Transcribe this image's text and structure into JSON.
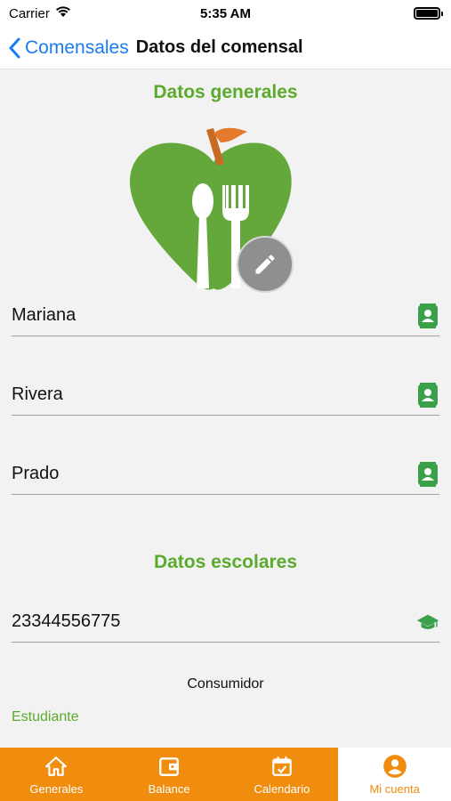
{
  "status_bar": {
    "carrier": "Carrier",
    "time": "5:35 AM"
  },
  "nav": {
    "back_label": "Comensales",
    "title": "Datos del comensal"
  },
  "general": {
    "title": "Datos generales",
    "fields": [
      {
        "value": "Mariana",
        "icon": "contact-card-icon"
      },
      {
        "value": "Rivera",
        "icon": "contact-card-icon"
      },
      {
        "value": "Prado",
        "icon": "contact-card-icon"
      }
    ]
  },
  "school": {
    "title": "Datos escolares",
    "id_value": "23344556775",
    "id_icon": "graduation-cap-icon",
    "consumer_label": "Consumidor",
    "consumer_type": "Estudiante"
  },
  "tabs": [
    {
      "label": "Generales",
      "icon": "home-icon"
    },
    {
      "label": "Balance",
      "icon": "wallet-icon"
    },
    {
      "label": "Calendario",
      "icon": "calendar-icon"
    },
    {
      "label": "Mi cuenta",
      "icon": "account-icon",
      "active": true
    }
  ],
  "colors": {
    "accent_green": "#5aab2c",
    "accent_orange": "#f08c0e",
    "link_blue": "#1a7cf0"
  }
}
